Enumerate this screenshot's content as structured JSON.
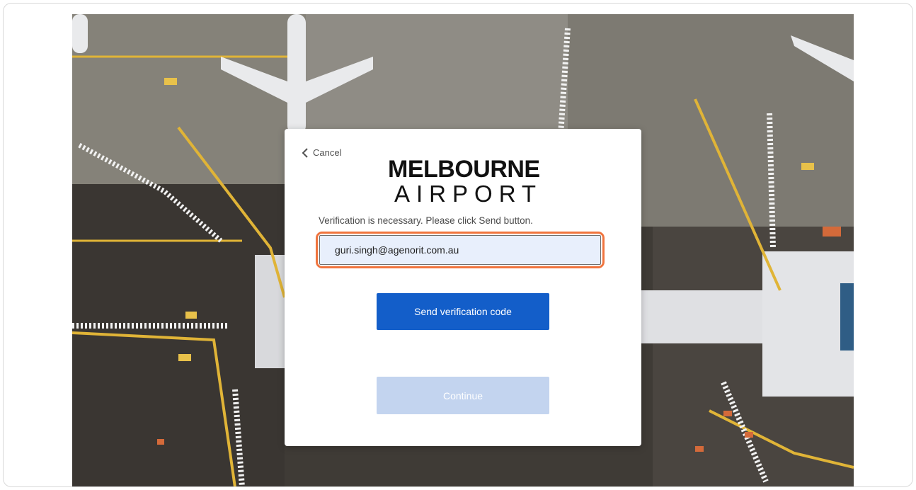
{
  "dialog": {
    "cancel_label": "Cancel",
    "logo": {
      "line1": "MELBOURNE",
      "line2": "AIRPORT"
    },
    "instructions": "Verification is necessary. Please click Send button.",
    "email": {
      "value": "guri.singh@agenorit.com.au",
      "placeholder": ""
    },
    "send_button_label": "Send verification code",
    "continue_button_label": "Continue"
  },
  "colors": {
    "primary_button": "#135ec9",
    "disabled_button": "#c3d4ef",
    "focus_highlight": "#f0743e",
    "input_fill": "#e8effc"
  },
  "icons": {
    "cancel": "chevron-left-icon"
  }
}
